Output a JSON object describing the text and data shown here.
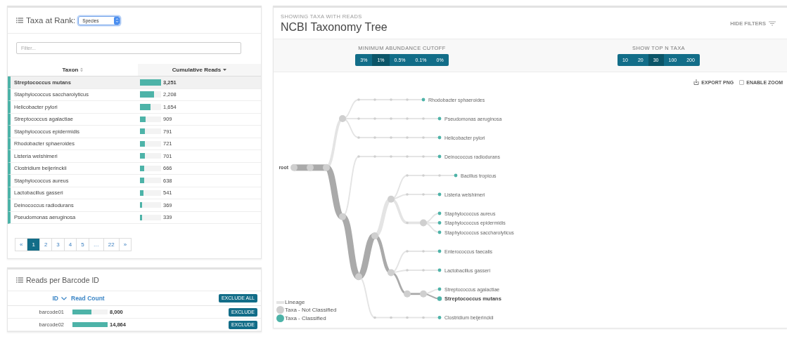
{
  "taxa_panel": {
    "title": "Taxa at Rank:",
    "rank_select": "Species",
    "filter": {
      "placeholder": "Filter..."
    },
    "columns": [
      "Taxon",
      "Cumulative Reads"
    ],
    "rows": [
      {
        "taxon": "Streptococcus mutans",
        "reads": "3,251",
        "level": 1,
        "selected": true
      },
      {
        "taxon": "Staphylococcus saccharolyticus",
        "reads": "2,208",
        "level": 0.68,
        "selected": false
      },
      {
        "taxon": "Helicobacter pylori",
        "reads": "1,654",
        "level": 0.51,
        "selected": false
      },
      {
        "taxon": "Streptococcus agalactiae",
        "reads": "909",
        "level": 0.28,
        "selected": false
      },
      {
        "taxon": "Staphylococcus epidermidis",
        "reads": "791",
        "level": 0.24,
        "selected": false
      },
      {
        "taxon": "Rhodobacter sphaeroides",
        "reads": "721",
        "level": 0.22,
        "selected": false
      },
      {
        "taxon": "Listeria welshimeri",
        "reads": "701",
        "level": 0.22,
        "selected": false
      },
      {
        "taxon": "Clostridium beijerinckii",
        "reads": "666",
        "level": 0.2,
        "selected": false
      },
      {
        "taxon": "Staphylococcus aureus",
        "reads": "638",
        "level": 0.2,
        "selected": false
      },
      {
        "taxon": "Lactobacillus gasseri",
        "reads": "541",
        "level": 0.17,
        "selected": false
      },
      {
        "taxon": "Deinococcus radiodurans",
        "reads": "369",
        "level": 0.11,
        "selected": false
      },
      {
        "taxon": "Pseudomonas aeruginosa",
        "reads": "339",
        "level": 0.1,
        "selected": false
      }
    ],
    "pages": [
      {
        "label": "«",
        "selected": false
      },
      {
        "label": "1",
        "selected": true
      },
      {
        "label": "2",
        "selected": false
      },
      {
        "label": "3",
        "selected": false
      },
      {
        "label": "4",
        "selected": false
      },
      {
        "label": "5",
        "selected": false
      },
      {
        "label": "…",
        "selected": false
      },
      {
        "label": "22",
        "selected": false
      },
      {
        "label": "»",
        "selected": false
      }
    ]
  },
  "barcode_panel": {
    "title": "Reads per Barcode ID",
    "columns": [
      "ID",
      "Read Count"
    ],
    "exclude_all": "EXCLUDE ALL",
    "rows": [
      {
        "id": "barcode01",
        "count": "8,000",
        "level": 0.54,
        "action": "EXCLUDE"
      },
      {
        "id": "barcode02",
        "count": "14,864",
        "level": 1,
        "action": "EXCLUDE"
      }
    ]
  },
  "tree_panel": {
    "subtitle": "SHOWING TAXA WITH READS",
    "title": "NCBI Taxonomy Tree",
    "hide_filters": "HIDE FILTERS",
    "filters": [
      {
        "label": "MINIMUM ABUNDANCE CUTOFF",
        "options": [
          {
            "label": "3%",
            "selected": false
          },
          {
            "label": "1%",
            "selected": true
          },
          {
            "label": "0.5%",
            "selected": false
          },
          {
            "label": "0.1%",
            "selected": false
          },
          {
            "label": "0%",
            "selected": false
          }
        ]
      },
      {
        "label": "SHOW TOP N TAXA",
        "options": [
          {
            "label": "10",
            "selected": false
          },
          {
            "label": "20",
            "selected": false
          },
          {
            "label": "30",
            "selected": true
          },
          {
            "label": "100",
            "selected": false
          },
          {
            "label": "200",
            "selected": false
          }
        ]
      }
    ],
    "export_label": "EXPORT PNG",
    "zoom_label": "ENABLE ZOOM",
    "zoom_enabled": false,
    "tree": {
      "label": "root",
      "children": [
        {
          "children": [
            {
              "children": [
                {
                  "children": [
                    {
                      "children": [
                        {
                          "children": [
                            {
                              "children": [
                                {
                                  "children": [
                                    {
                                      "label": "Rhodobacter sphaeroides",
                                      "classified": true,
                                      "selected": false
                                    }
                                  ]
                                }
                              ]
                            }
                          ]
                        }
                      ]
                    },
                    {
                      "children": [
                        {
                          "children": [
                            {
                              "children": [
                                {
                                  "children": [
                                    {
                                      "children": [
                                        {
                                          "label": "Pseudomonas aeruginosa",
                                          "classified": true,
                                          "selected": false
                                        }
                                      ]
                                    }
                                  ]
                                }
                              ]
                            }
                          ]
                        }
                      ]
                    },
                    {
                      "children": [
                        {
                          "children": [
                            {
                              "children": [
                                {
                                  "children": [
                                    {
                                      "children": [
                                        {
                                          "label": "Helicobacter pylori",
                                          "classified": true,
                                          "selected": false
                                        }
                                      ]
                                    }
                                  ]
                                }
                              ]
                            }
                          ]
                        }
                      ]
                    }
                  ]
                },
                {
                  "children": [
                    {
                      "children": [
                        {
                          "children": [
                            {
                              "children": [
                                {
                                  "children": [
                                    {
                                      "children": [
                                        {
                                          "label": "Deinococcus radiodurans",
                                          "classified": true,
                                          "selected": false
                                        }
                                      ]
                                    }
                                  ]
                                }
                              ]
                            }
                          ]
                        }
                      ]
                    },
                    {
                      "children": [
                        {
                          "children": [
                            {
                              "children": [
                                {
                                  "children": [
                                    {
                                      "children": [
                                        {
                                          "children": [
                                            {
                                              "label": "Bacillus tropicus",
                                              "classified": true,
                                              "selected": false
                                            }
                                          ]
                                        }
                                      ]
                                    }
                                  ]
                                },
                                {
                                  "children": [
                                    {
                                      "children": [
                                        {
                                          "label": "Listeria welshimeri",
                                          "classified": true,
                                          "selected": false
                                        }
                                      ]
                                    }
                                  ]
                                },
                                {
                                  "children": [
                                    {
                                      "children": [
                                        {
                                          "label": "Staphylococcus aureus",
                                          "classified": true,
                                          "selected": false
                                        },
                                        {
                                          "label": "Staphylococcus epidermidis",
                                          "classified": true,
                                          "selected": false
                                        },
                                        {
                                          "label": "Staphylococcus saccharolyticus",
                                          "classified": true,
                                          "selected": false
                                        }
                                      ]
                                    }
                                  ]
                                }
                              ]
                            },
                            {
                              "children": [
                                {
                                  "children": [
                                    {
                                      "children": [
                                        {
                                          "label": "Enterococcus faecalis",
                                          "classified": true,
                                          "selected": false
                                        }
                                      ]
                                    }
                                  ]
                                },
                                {
                                  "children": [
                                    {
                                      "children": [
                                        {
                                          "label": "Lactobacillus gasseri",
                                          "classified": true,
                                          "selected": false
                                        }
                                      ]
                                    }
                                  ]
                                },
                                {
                                  "children": [
                                    {
                                      "children": [
                                        {
                                          "label": "Streptococcus agalactiae",
                                          "classified": true,
                                          "selected": false
                                        },
                                        {
                                          "label": "Streptococcus mutans",
                                          "classified": true,
                                          "selected": true
                                        }
                                      ]
                                    }
                                  ]
                                }
                              ]
                            }
                          ]
                        },
                        {
                          "children": [
                            {
                              "children": [
                                {
                                  "children": [
                                    {
                                      "children": [
                                        {
                                          "label": "Clostridium beijerinckii",
                                          "classified": true,
                                          "selected": false
                                        }
                                      ]
                                    }
                                  ]
                                }
                              ]
                            }
                          ]
                        }
                      ]
                    }
                  ]
                }
              ]
            }
          ]
        }
      ]
    },
    "legend": [
      {
        "label": "Lineage",
        "kind": "line"
      },
      {
        "label": "Taxa - Not Classified",
        "kind": "unclassified"
      },
      {
        "label": "Taxa - Classified",
        "kind": "classified"
      }
    ]
  }
}
